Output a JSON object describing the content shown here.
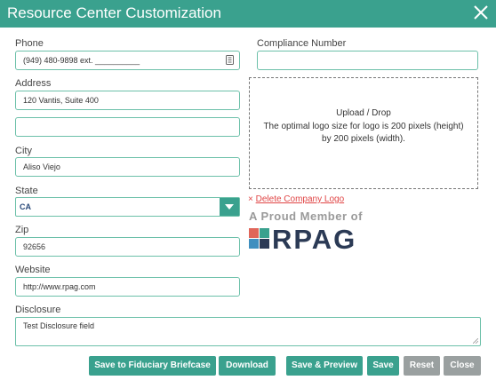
{
  "window": {
    "title": "Resource Center Customization"
  },
  "form": {
    "phone": {
      "label": "Phone",
      "value": "(949) 480-9898 ext. __________"
    },
    "compliance": {
      "label": "Compliance Number",
      "value": ""
    },
    "address": {
      "label": "Address",
      "value": "120 Vantis, Suite 400",
      "value2": ""
    },
    "city": {
      "label": "City",
      "value": "Aliso Viejo"
    },
    "state": {
      "label": "State",
      "value": "CA"
    },
    "zip": {
      "label": "Zip",
      "value": "92656"
    },
    "website": {
      "label": "Website",
      "value": "http://www.rpag.com"
    },
    "disclosure": {
      "label": "Disclosure",
      "value": "Test Disclosure field"
    }
  },
  "logo": {
    "upload_title": "Upload / Drop",
    "upload_desc": "The optimal logo size for logo is 200 pixels (height) by 200 pixels (width).",
    "delete_link": "Delete Company Logo",
    "delete_mark": "×",
    "proud_member": "A Proud Member of",
    "brand": "RPAG",
    "brand_colors": [
      "#e0665a",
      "#3aa18e",
      "#3f8fbf",
      "#2b3a55"
    ]
  },
  "buttons": {
    "save_briefcase": "Save to Fiduciary Briefcase",
    "download": "Download",
    "save_preview": "Save & Preview",
    "save": "Save",
    "reset": "Reset",
    "close": "Close"
  },
  "colors": {
    "accent": "#3aa18e",
    "disabled": "#9aa0a0",
    "danger": "#e04545"
  }
}
